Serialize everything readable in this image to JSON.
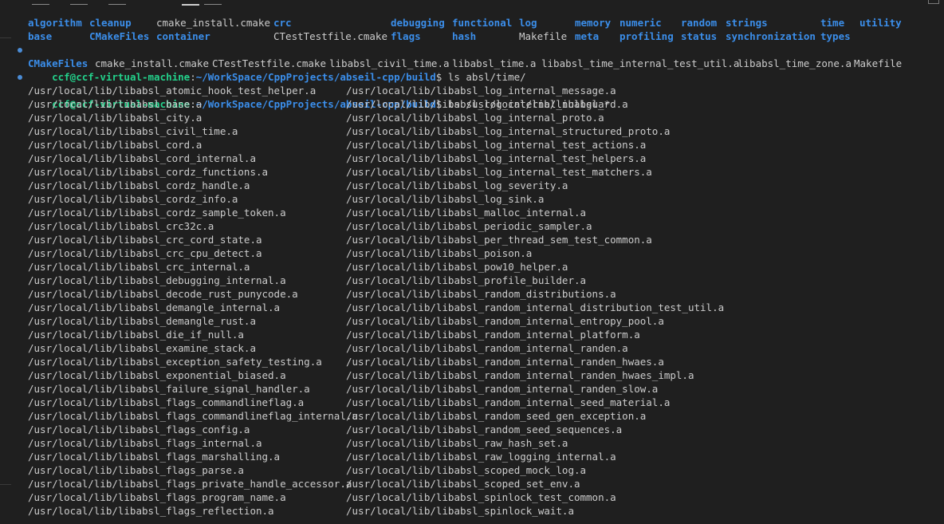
{
  "ls_root": {
    "row1": [
      {
        "t": "algorithm",
        "k": "dir"
      },
      {
        "t": "cleanup",
        "k": "dir"
      },
      {
        "t": "cmake_install.cmake",
        "k": "file"
      },
      {
        "t": "crc",
        "k": "dir"
      },
      {
        "t": "debugging",
        "k": "dir"
      },
      {
        "t": "functional",
        "k": "dir"
      },
      {
        "t": "log",
        "k": "dir"
      },
      {
        "t": "memory",
        "k": "dir"
      },
      {
        "t": "numeric",
        "k": "dir"
      },
      {
        "t": "random",
        "k": "dir"
      },
      {
        "t": "strings",
        "k": "dir"
      },
      {
        "t": "time",
        "k": "dir"
      },
      {
        "t": "utility",
        "k": "dir"
      }
    ],
    "row2": [
      {
        "t": "base",
        "k": "dir"
      },
      {
        "t": "CMakeFiles",
        "k": "dir"
      },
      {
        "t": "container",
        "k": "dir"
      },
      {
        "t": "CTestTestfile.cmake",
        "k": "file"
      },
      {
        "t": "flags",
        "k": "dir"
      },
      {
        "t": "hash",
        "k": "dir"
      },
      {
        "t": "Makefile",
        "k": "file"
      },
      {
        "t": "meta",
        "k": "dir"
      },
      {
        "t": "profiling",
        "k": "dir"
      },
      {
        "t": "status",
        "k": "dir"
      },
      {
        "t": "synchronization",
        "k": "dir"
      },
      {
        "t": "types",
        "k": "dir"
      }
    ]
  },
  "prompt": {
    "user": "ccf@ccf-virtual-machine",
    "sep": ":",
    "path": "~/WorkSpace/CppProjects/abseil-cpp/build",
    "dollar": "$"
  },
  "cmd1": " ls absl/time/",
  "ls_time": [
    {
      "t": "CMakeFiles",
      "k": "dir"
    },
    {
      "t": "cmake_install.cmake",
      "k": "file"
    },
    {
      "t": "CTestTestfile.cmake",
      "k": "file"
    },
    {
      "t": "libabsl_civil_time.a",
      "k": "file"
    },
    {
      "t": "libabsl_time.a",
      "k": "file"
    },
    {
      "t": "libabsl_time_internal_test_util.a",
      "k": "file"
    },
    {
      "t": "libabsl_time_zone.a",
      "k": "file"
    },
    {
      "t": "Makefile",
      "k": "file"
    }
  ],
  "cmd2": " ls /usr/local/lib/libabsl_*",
  "libs_left": [
    "/usr/local/lib/libabsl_atomic_hook_test_helper.a",
    "/usr/local/lib/libabsl_base.a",
    "/usr/local/lib/libabsl_city.a",
    "/usr/local/lib/libabsl_civil_time.a",
    "/usr/local/lib/libabsl_cord.a",
    "/usr/local/lib/libabsl_cord_internal.a",
    "/usr/local/lib/libabsl_cordz_functions.a",
    "/usr/local/lib/libabsl_cordz_handle.a",
    "/usr/local/lib/libabsl_cordz_info.a",
    "/usr/local/lib/libabsl_cordz_sample_token.a",
    "/usr/local/lib/libabsl_crc32c.a",
    "/usr/local/lib/libabsl_crc_cord_state.a",
    "/usr/local/lib/libabsl_crc_cpu_detect.a",
    "/usr/local/lib/libabsl_crc_internal.a",
    "/usr/local/lib/libabsl_debugging_internal.a",
    "/usr/local/lib/libabsl_decode_rust_punycode.a",
    "/usr/local/lib/libabsl_demangle_internal.a",
    "/usr/local/lib/libabsl_demangle_rust.a",
    "/usr/local/lib/libabsl_die_if_null.a",
    "/usr/local/lib/libabsl_examine_stack.a",
    "/usr/local/lib/libabsl_exception_safety_testing.a",
    "/usr/local/lib/libabsl_exponential_biased.a",
    "/usr/local/lib/libabsl_failure_signal_handler.a",
    "/usr/local/lib/libabsl_flags_commandlineflag.a",
    "/usr/local/lib/libabsl_flags_commandlineflag_internal.a",
    "/usr/local/lib/libabsl_flags_config.a",
    "/usr/local/lib/libabsl_flags_internal.a",
    "/usr/local/lib/libabsl_flags_marshalling.a",
    "/usr/local/lib/libabsl_flags_parse.a",
    "/usr/local/lib/libabsl_flags_private_handle_accessor.a",
    "/usr/local/lib/libabsl_flags_program_name.a",
    "/usr/local/lib/libabsl_flags_reflection.a"
  ],
  "libs_right": [
    "/usr/local/lib/libabsl_log_internal_message.a",
    "/usr/local/lib/libabsl_log_internal_nullguard.a",
    "/usr/local/lib/libabsl_log_internal_proto.a",
    "/usr/local/lib/libabsl_log_internal_structured_proto.a",
    "/usr/local/lib/libabsl_log_internal_test_actions.a",
    "/usr/local/lib/libabsl_log_internal_test_helpers.a",
    "/usr/local/lib/libabsl_log_internal_test_matchers.a",
    "/usr/local/lib/libabsl_log_severity.a",
    "/usr/local/lib/libabsl_log_sink.a",
    "/usr/local/lib/libabsl_malloc_internal.a",
    "/usr/local/lib/libabsl_periodic_sampler.a",
    "/usr/local/lib/libabsl_per_thread_sem_test_common.a",
    "/usr/local/lib/libabsl_poison.a",
    "/usr/local/lib/libabsl_pow10_helper.a",
    "/usr/local/lib/libabsl_profile_builder.a",
    "/usr/local/lib/libabsl_random_distributions.a",
    "/usr/local/lib/libabsl_random_internal_distribution_test_util.a",
    "/usr/local/lib/libabsl_random_internal_entropy_pool.a",
    "/usr/local/lib/libabsl_random_internal_platform.a",
    "/usr/local/lib/libabsl_random_internal_randen.a",
    "/usr/local/lib/libabsl_random_internal_randen_hwaes.a",
    "/usr/local/lib/libabsl_random_internal_randen_hwaes_impl.a",
    "/usr/local/lib/libabsl_random_internal_randen_slow.a",
    "/usr/local/lib/libabsl_random_internal_seed_material.a",
    "/usr/local/lib/libabsl_random_seed_gen_exception.a",
    "/usr/local/lib/libabsl_random_seed_sequences.a",
    "/usr/local/lib/libabsl_raw_hash_set.a",
    "/usr/local/lib/libabsl_raw_logging_internal.a",
    "/usr/local/lib/libabsl_scoped_mock_log.a",
    "/usr/local/lib/libabsl_scoped_set_env.a",
    "/usr/local/lib/libabsl_spinlock_test_common.a",
    "/usr/local/lib/libabsl_spinlock_wait.a"
  ],
  "colors": {
    "background": "#1f1f1f",
    "text": "#cccccc",
    "directory": "#3b8eea",
    "prompt_user": "#23d18b",
    "prompt_path": "#3b8eea",
    "decoration_dot": "#4b8cd6"
  },
  "icons": {
    "decoration": "circle-dot-icon",
    "close": "close-icon"
  }
}
